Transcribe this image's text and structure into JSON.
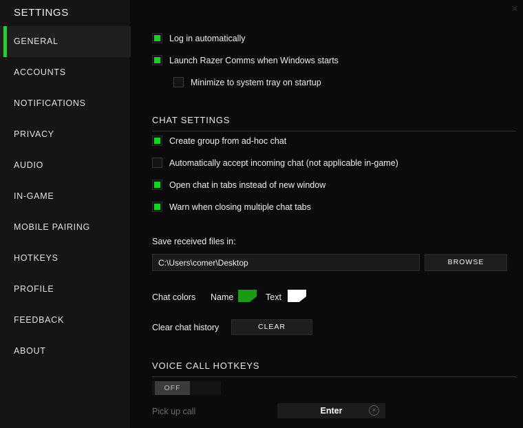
{
  "window": {
    "close_icon": "✕"
  },
  "sidebar": {
    "title": "SETTINGS",
    "items": [
      {
        "label": "GENERAL",
        "active": true
      },
      {
        "label": "ACCOUNTS",
        "active": false
      },
      {
        "label": "NOTIFICATIONS",
        "active": false
      },
      {
        "label": "PRIVACY",
        "active": false
      },
      {
        "label": "AUDIO",
        "active": false
      },
      {
        "label": "IN-GAME",
        "active": false
      },
      {
        "label": "MOBILE PAIRING",
        "active": false
      },
      {
        "label": "HOTKEYS",
        "active": false
      },
      {
        "label": "PROFILE",
        "active": false
      },
      {
        "label": "FEEDBACK",
        "active": false
      },
      {
        "label": "ABOUT",
        "active": false
      }
    ]
  },
  "startup": {
    "log_in_automatically": {
      "label": "Log in automatically",
      "checked": true
    },
    "launch_on_windows_start": {
      "label": "Launch Razer Comms when Windows starts",
      "checked": true
    },
    "minimize_to_tray": {
      "label": "Minimize to system tray on startup",
      "checked": false
    }
  },
  "chat_settings": {
    "section_title": "CHAT SETTINGS",
    "create_group": {
      "label": "Create group from ad-hoc chat",
      "checked": true
    },
    "auto_accept": {
      "label": "Automatically accept incoming chat (not applicable in-game)",
      "checked": false
    },
    "open_in_tabs": {
      "label": "Open chat in tabs instead of new window",
      "checked": true
    },
    "warn_closing": {
      "label": "Warn when closing multiple chat tabs",
      "checked": true
    },
    "save_files_label": "Save received files in:",
    "save_files_path": "C:\\Users\\comer\\Desktop",
    "browse_label": "BROWSE",
    "chat_colors_label": "Chat colors",
    "name_color_label": "Name",
    "name_color_value": "#1a9a15",
    "text_color_label": "Text",
    "text_color_value": "#ffffff",
    "clear_history_label": "Clear chat history",
    "clear_button_label": "CLEAR"
  },
  "voice_call_hotkeys": {
    "section_title": "VOICE CALL HOTKEYS",
    "toggle_state": "OFF",
    "pick_up_call_label": "Pick up call",
    "pick_up_call_key": "Enter",
    "clear_icon": "×"
  },
  "colors": {
    "accent_green": "#22d32a",
    "checkbox_green": "#13d61c",
    "sidebar_bg": "#141414",
    "panel_bg": "#0b0b0b"
  }
}
